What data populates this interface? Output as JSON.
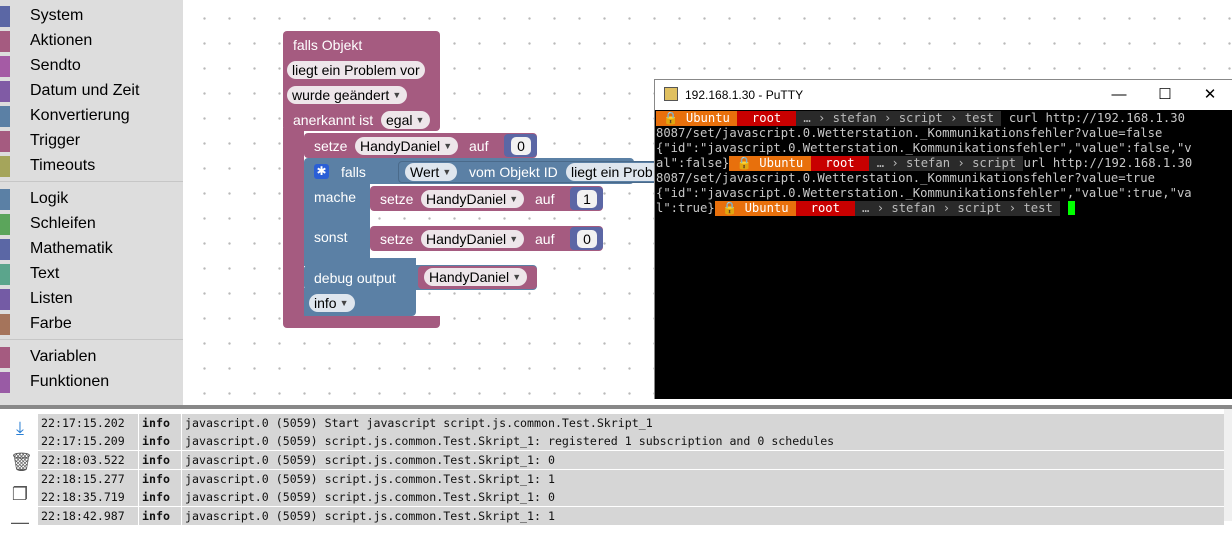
{
  "toolbox": {
    "categories": [
      {
        "label": "System",
        "color": "#5b67a5"
      },
      {
        "label": "Aktionen",
        "color": "#a55b80"
      },
      {
        "label": "Sendto",
        "color": "#a55ba5"
      },
      {
        "label": "Datum und Zeit",
        "color": "#805ba5"
      },
      {
        "label": "Konvertierung",
        "color": "#5b80a5"
      },
      {
        "label": "Trigger",
        "color": "#a55b80"
      },
      {
        "label": "Timeouts",
        "color": "#a5a55b"
      },
      {
        "label": "Logik",
        "color": "#5b80a5"
      },
      {
        "label": "Schleifen",
        "color": "#5ba55b"
      },
      {
        "label": "Mathematik",
        "color": "#5b67a5"
      },
      {
        "label": "Text",
        "color": "#5ba58c"
      },
      {
        "label": "Listen",
        "color": "#745ba5"
      },
      {
        "label": "Farbe",
        "color": "#a5745b"
      },
      {
        "label": "Variablen",
        "color": "#a55b80"
      },
      {
        "label": "Funktionen",
        "color": "#995ba5"
      }
    ]
  },
  "blocks": {
    "trigger_title": "falls Objekt",
    "trigger_cond": "liegt ein Problem vor",
    "trigger_change": "wurde geändert",
    "ack_label": "anerkannt ist",
    "ack_value": "egal",
    "set1_label": "setze",
    "set1_var": "HandyDaniel",
    "set1_auf": "auf",
    "set1_val": "0",
    "if_label": "falls",
    "if_value": "Wert",
    "if_from": "vom Objekt ID",
    "if_obj": "liegt ein Prob",
    "do_label": "mache",
    "do_set": "setze",
    "do_var": "HandyDaniel",
    "do_auf": "auf",
    "do_val": "1",
    "else_label": "sonst",
    "else_set": "setze",
    "else_var": "HandyDaniel",
    "else_auf": "auf",
    "else_val": "0",
    "debug_label": "debug output",
    "debug_var": "HandyDaniel",
    "debug_level": "info"
  },
  "colors": {
    "trigger_block": "#a55b80",
    "logic_block": "#5b80a5",
    "var_block": "#a55b80",
    "number_block": "#5b67a5",
    "putty_green": "#00ff00"
  },
  "putty": {
    "title": "192.168.1.30 - PuTTY",
    "minimize": "—",
    "maximize": "☐",
    "close": "✕",
    "prompt": {
      "os": "Ubuntu",
      "user": "root",
      "ellipsis": "…",
      "dir1": "stefan",
      "dir2": "script",
      "dir3": "test"
    },
    "line1_cmd": "curl http://192.168.1.30",
    "line2": "8087/set/javascript.0.Wetterstation._Kommunikationsfehler?value=false",
    "line3": "{\"id\":\"javascript.0.Wetterstation._Kommunikationsfehler\",\"value\":false,\"v",
    "line4_pre": "al\":false}",
    "line4_cmd": "url http://192.168.1.30",
    "line5": "8087/set/javascript.0.Wetterstation._Kommunikationsfehler?value=true",
    "line6": "{\"id\":\"javascript.0.Wetterstation._Kommunikationsfehler\",\"value\":true,\"va",
    "line7_pre": "l\":true}"
  },
  "log": {
    "rows": [
      {
        "time": "22:17:15.202",
        "level": "info",
        "source": "javascript.0 (5059)",
        "message": "Start javascript script.js.common.Test.Skript_1"
      },
      {
        "time": "22:17:15.209",
        "level": "info",
        "source": "javascript.0 (5059)",
        "message": "script.js.common.Test.Skript_1: registered 1 subscription and 0 schedules"
      },
      {
        "time": "22:18:03.522",
        "level": "info",
        "source": "javascript.0 (5059)",
        "message": "script.js.common.Test.Skript_1: 0"
      },
      {
        "time": "22:18:15.277",
        "level": "info",
        "source": "javascript.0 (5059)",
        "message": "script.js.common.Test.Skript_1: 1"
      },
      {
        "time": "22:18:35.719",
        "level": "info",
        "source": "javascript.0 (5059)",
        "message": "script.js.common.Test.Skript_1: 0"
      },
      {
        "time": "22:18:42.987",
        "level": "info",
        "source": "javascript.0 (5059)",
        "message": "script.js.common.Test.Skript_1: 1"
      }
    ]
  }
}
